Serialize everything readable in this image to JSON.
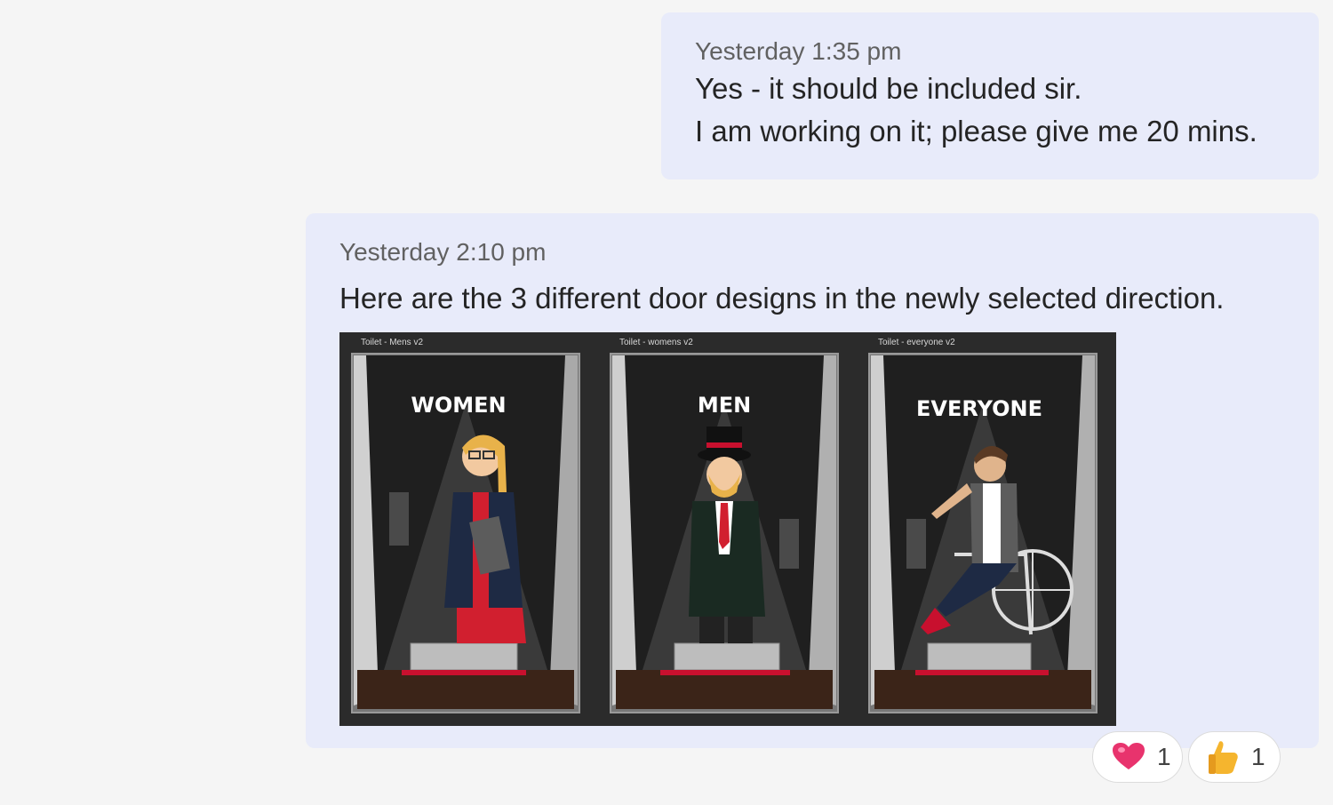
{
  "messages": [
    {
      "timestamp": "Yesterday 1:35 pm",
      "lines": [
        "Yes - it should be included sir.",
        "I am working on it; please give me 20 mins."
      ]
    },
    {
      "timestamp": "Yesterday 2:10 pm",
      "lines": [
        "Here are the 3 different door designs in the newly selected direction."
      ],
      "attachment": {
        "panels": [
          {
            "label": "Toilet - Mens v2",
            "sign": "WOMEN"
          },
          {
            "label": "Toilet - womens v2",
            "sign": "MEN"
          },
          {
            "label": "Toilet - everyone v2",
            "sign": "EVERYONE"
          }
        ]
      }
    }
  ],
  "reactions": [
    {
      "icon": "heart-icon",
      "count": "1"
    },
    {
      "icon": "thumbs-up-icon",
      "count": "1"
    }
  ],
  "colors": {
    "bubble": "#e8ebfa",
    "background": "#f5f5f5",
    "heart": "#e8336d",
    "thumb": "#f5b52e"
  }
}
